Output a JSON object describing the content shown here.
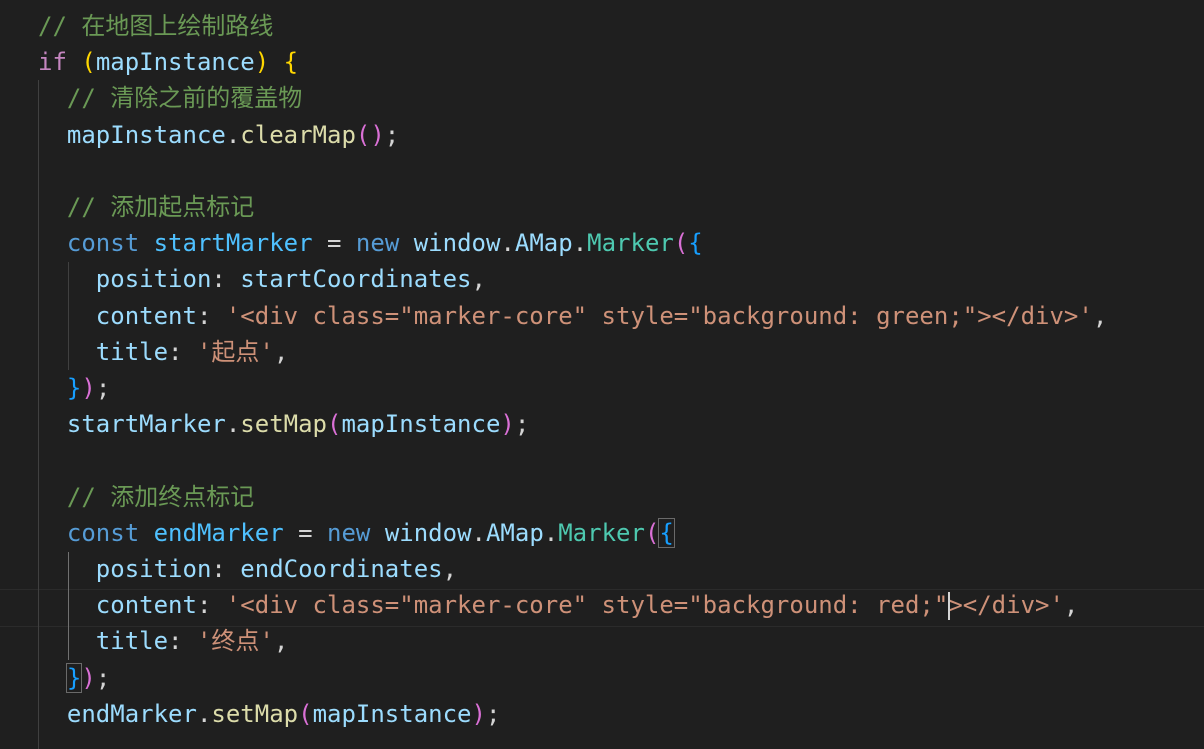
{
  "editor": {
    "theme_colors": {
      "background": "#1f1f1f",
      "comment": "#6a9955",
      "keyword": "#569cd6",
      "control": "#c586c0",
      "variable": "#9cdcfe",
      "constant": "#4fc1ff",
      "function": "#dcdcaa",
      "class": "#4ec9b0",
      "string": "#ce9178",
      "bracket_level_1": "#ffd700",
      "bracket_level_2": "#da70d6",
      "bracket_level_3": "#179fff"
    },
    "lines": [
      {
        "tokens": [
          {
            "t": "// 在地图上绘制路线",
            "c": "cm"
          }
        ]
      },
      {
        "tokens": [
          {
            "t": "if",
            "c": "ctl"
          },
          {
            "t": " ",
            "c": "pun"
          },
          {
            "t": "(",
            "c": "b1"
          },
          {
            "t": "mapInstance",
            "c": "var"
          },
          {
            "t": ")",
            "c": "b1"
          },
          {
            "t": " ",
            "c": "pun"
          },
          {
            "t": "{",
            "c": "b1"
          }
        ]
      },
      {
        "tokens": [
          {
            "t": "  // 清除之前的覆盖物",
            "c": "cm"
          }
        ]
      },
      {
        "tokens": [
          {
            "t": "  mapInstance",
            "c": "var"
          },
          {
            "t": ".",
            "c": "pun"
          },
          {
            "t": "clearMap",
            "c": "fn"
          },
          {
            "t": "(",
            "c": "b2"
          },
          {
            "t": ")",
            "c": "b2"
          },
          {
            "t": ";",
            "c": "pun"
          }
        ]
      },
      {
        "tokens": []
      },
      {
        "tokens": [
          {
            "t": "  // 添加起点标记",
            "c": "cm"
          }
        ]
      },
      {
        "tokens": [
          {
            "t": "  const",
            "c": "kw"
          },
          {
            "t": " ",
            "c": "pun"
          },
          {
            "t": "startMarker",
            "c": "const"
          },
          {
            "t": " = ",
            "c": "pun"
          },
          {
            "t": "new",
            "c": "kw"
          },
          {
            "t": " ",
            "c": "pun"
          },
          {
            "t": "window",
            "c": "var"
          },
          {
            "t": ".",
            "c": "pun"
          },
          {
            "t": "AMap",
            "c": "var"
          },
          {
            "t": ".",
            "c": "pun"
          },
          {
            "t": "Marker",
            "c": "cls"
          },
          {
            "t": "(",
            "c": "b2"
          },
          {
            "t": "{",
            "c": "b3"
          }
        ]
      },
      {
        "tokens": [
          {
            "t": "    position",
            "c": "var"
          },
          {
            "t": ": ",
            "c": "pun"
          },
          {
            "t": "startCoordinates",
            "c": "var"
          },
          {
            "t": ",",
            "c": "pun"
          }
        ]
      },
      {
        "tokens": [
          {
            "t": "    content",
            "c": "var"
          },
          {
            "t": ": ",
            "c": "pun"
          },
          {
            "t": "'<div class=\"marker-core\" style=\"background: green;\"></div>'",
            "c": "str"
          },
          {
            "t": ",",
            "c": "pun"
          }
        ]
      },
      {
        "tokens": [
          {
            "t": "    title",
            "c": "var"
          },
          {
            "t": ": ",
            "c": "pun"
          },
          {
            "t": "'起点'",
            "c": "str"
          },
          {
            "t": ",",
            "c": "pun"
          }
        ]
      },
      {
        "tokens": [
          {
            "t": "  ",
            "c": "pun"
          },
          {
            "t": "}",
            "c": "b3"
          },
          {
            "t": ")",
            "c": "b2"
          },
          {
            "t": ";",
            "c": "pun"
          }
        ]
      },
      {
        "tokens": [
          {
            "t": "  startMarker",
            "c": "var"
          },
          {
            "t": ".",
            "c": "pun"
          },
          {
            "t": "setMap",
            "c": "fn"
          },
          {
            "t": "(",
            "c": "b2"
          },
          {
            "t": "mapInstance",
            "c": "var"
          },
          {
            "t": ")",
            "c": "b2"
          },
          {
            "t": ";",
            "c": "pun"
          }
        ]
      },
      {
        "tokens": []
      },
      {
        "tokens": [
          {
            "t": "  // 添加终点标记",
            "c": "cm"
          }
        ]
      },
      {
        "tokens": [
          {
            "t": "  const",
            "c": "kw"
          },
          {
            "t": " ",
            "c": "pun"
          },
          {
            "t": "endMarker",
            "c": "const"
          },
          {
            "t": " = ",
            "c": "pun"
          },
          {
            "t": "new",
            "c": "kw"
          },
          {
            "t": " ",
            "c": "pun"
          },
          {
            "t": "window",
            "c": "var"
          },
          {
            "t": ".",
            "c": "pun"
          },
          {
            "t": "AMap",
            "c": "var"
          },
          {
            "t": ".",
            "c": "pun"
          },
          {
            "t": "Marker",
            "c": "cls"
          },
          {
            "t": "(",
            "c": "b2"
          },
          {
            "t": "{",
            "c": "b3",
            "box": true
          }
        ]
      },
      {
        "tokens": [
          {
            "t": "    position",
            "c": "var"
          },
          {
            "t": ": ",
            "c": "pun"
          },
          {
            "t": "endCoordinates",
            "c": "var"
          },
          {
            "t": ",",
            "c": "pun"
          }
        ]
      },
      {
        "tokens": [
          {
            "t": "    content",
            "c": "var"
          },
          {
            "t": ": ",
            "c": "pun"
          },
          {
            "t": "'<div class=\"marker-core\" style=\"background: red;\"",
            "c": "str"
          },
          {
            "t": "",
            "c": "pun",
            "cursor": true
          },
          {
            "t": "></div>'",
            "c": "str"
          },
          {
            "t": ",",
            "c": "pun"
          }
        ],
        "current": true
      },
      {
        "tokens": [
          {
            "t": "    title",
            "c": "var"
          },
          {
            "t": ": ",
            "c": "pun"
          },
          {
            "t": "'终点'",
            "c": "str"
          },
          {
            "t": ",",
            "c": "pun"
          }
        ]
      },
      {
        "tokens": [
          {
            "t": "  ",
            "c": "pun"
          },
          {
            "t": "}",
            "c": "b3",
            "box": true
          },
          {
            "t": ")",
            "c": "b2"
          },
          {
            "t": ";",
            "c": "pun"
          }
        ]
      },
      {
        "tokens": [
          {
            "t": "  endMarker",
            "c": "var"
          },
          {
            "t": ".",
            "c": "pun"
          },
          {
            "t": "setMap",
            "c": "fn"
          },
          {
            "t": "(",
            "c": "b2"
          },
          {
            "t": "mapInstance",
            "c": "var"
          },
          {
            "t": ")",
            "c": "b2"
          },
          {
            "t": ";",
            "c": "pun"
          }
        ]
      }
    ]
  }
}
